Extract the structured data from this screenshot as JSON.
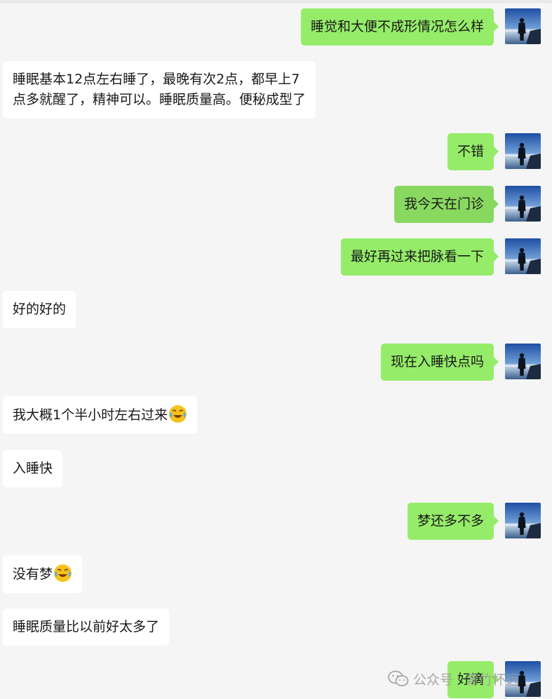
{
  "messages": [
    {
      "side": "right",
      "text": "睡觉和大便不成形情况怎么样"
    },
    {
      "side": "left",
      "text": "睡眠基本12点左右睡了，最晚有次2点，都早上7\n点多就醒了，精神可以。睡眠质量高。便秘成型了"
    },
    {
      "side": "right",
      "text": "不错"
    },
    {
      "side": "right",
      "text": "我今天在门诊"
    },
    {
      "side": "right",
      "text": "最好再过来把脉看一下"
    },
    {
      "side": "left",
      "text": "好的好的"
    },
    {
      "side": "right",
      "text": "现在入睡快点吗"
    },
    {
      "side": "left",
      "text": "我大概1个半小时左右过来",
      "emoji": "rofl-emoji"
    },
    {
      "side": "left",
      "text": "入睡快"
    },
    {
      "side": "right",
      "text": "梦还多不多"
    },
    {
      "side": "left",
      "text": "没有梦",
      "emoji": "rofl-emoji"
    },
    {
      "side": "left",
      "text": "睡眠质量比以前好太多了"
    },
    {
      "side": "right",
      "text": "好滴"
    }
  ],
  "watermark": {
    "text": "公众号 · 青竹怀远",
    "icon": "wechat-icon"
  },
  "colors": {
    "background": "#f5f5f5",
    "self_bubble": "#95ec69",
    "self_bubble_hover": "#89d961",
    "other_bubble": "#ffffff",
    "text": "#191919"
  }
}
